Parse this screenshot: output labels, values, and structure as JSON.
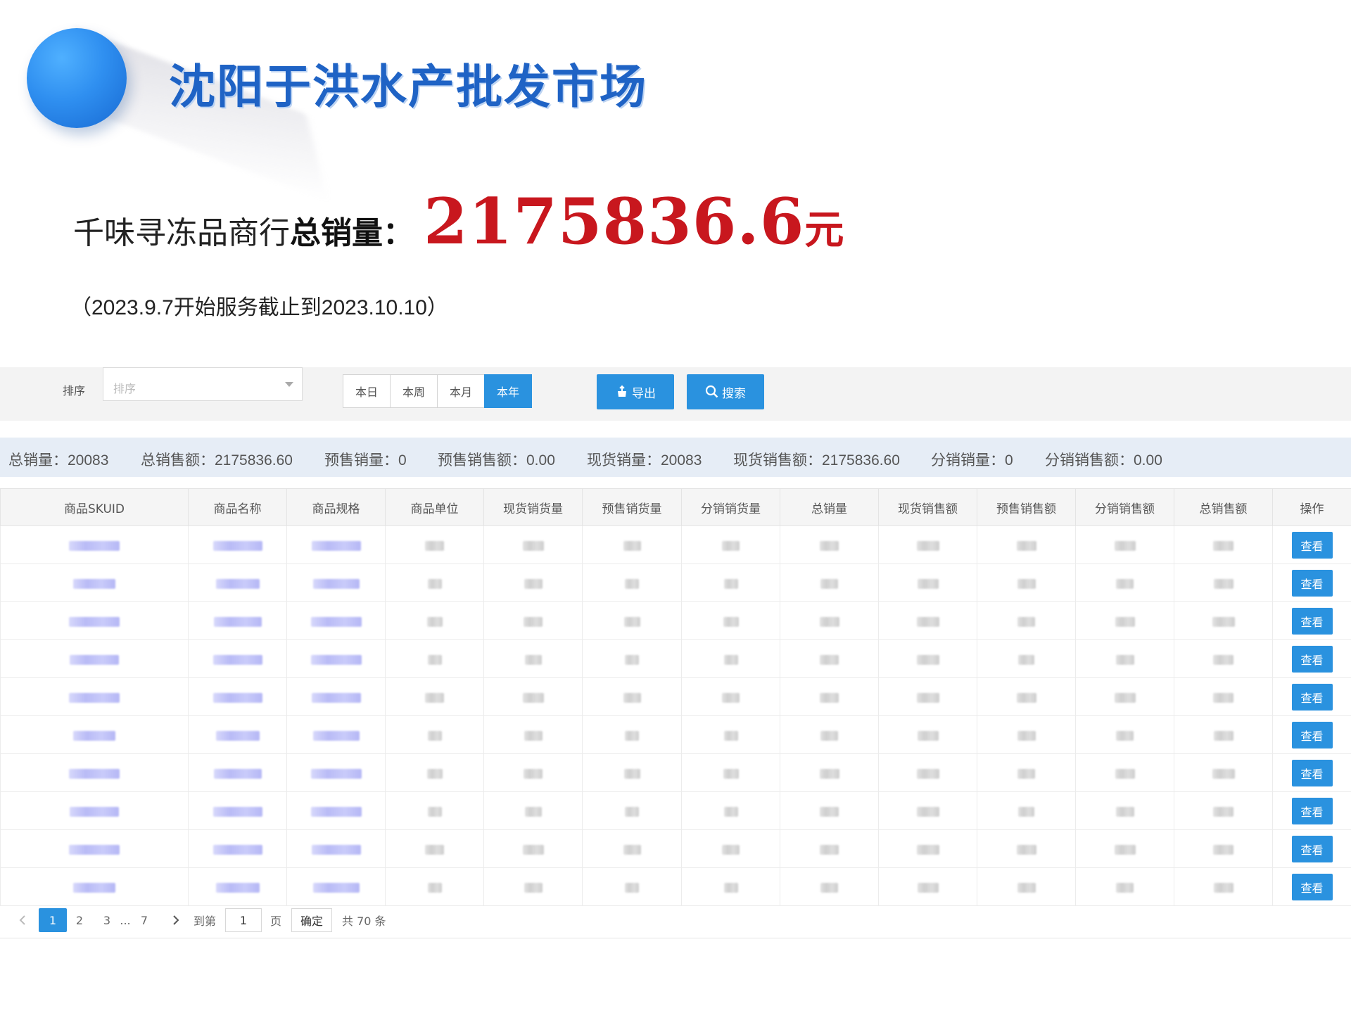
{
  "hero": {
    "market_title": "沈阳于洪水产批发市场",
    "shop_name": "千味寻冻品商行",
    "sales_label": "总销量：",
    "sales_amount": "2175836.6",
    "sales_unit": "元",
    "service_period": "（2023.9.7开始服务截止到2023.10.10）"
  },
  "filters": {
    "sort_label": "排序",
    "sort_placeholder": "排序",
    "ranges": [
      "本日",
      "本周",
      "本月",
      "本年"
    ],
    "active_range": "本年",
    "export_label": "导出",
    "search_label": "搜索"
  },
  "summary": [
    {
      "label": "总销量：",
      "value": "20083"
    },
    {
      "label": "总销售额：",
      "value": "2175836.60"
    },
    {
      "label": "预售销量：",
      "value": "0"
    },
    {
      "label": "预售销售额：",
      "value": "0.00"
    },
    {
      "label": "现货销量：",
      "value": "20083"
    },
    {
      "label": "现货销售额：",
      "value": "2175836.60"
    },
    {
      "label": "分销销量：",
      "value": "0"
    },
    {
      "label": "分销销售额：",
      "value": "0.00"
    }
  ],
  "table": {
    "columns": [
      "商品SKUID",
      "商品名称",
      "商品规格",
      "商品单位",
      "现货销货量",
      "预售销货量",
      "分销销货量",
      "总销量",
      "现货销售额",
      "预售销售额",
      "分销销售额",
      "总销售额",
      "操作"
    ],
    "row_action_label": "查看",
    "row_count": 10
  },
  "pagination": {
    "pages": [
      "1",
      "2",
      "3",
      "...",
      "7"
    ],
    "current_page": "1",
    "goto_label": "到第",
    "goto_value": "1",
    "page_suffix": "页",
    "confirm_label": "确定",
    "total_text": "共 70 条"
  },
  "colors": {
    "accent": "#2a92df",
    "title_blue": "#1f63c5",
    "sales_red": "#c8171e",
    "summary_bg": "#e6edf6"
  }
}
